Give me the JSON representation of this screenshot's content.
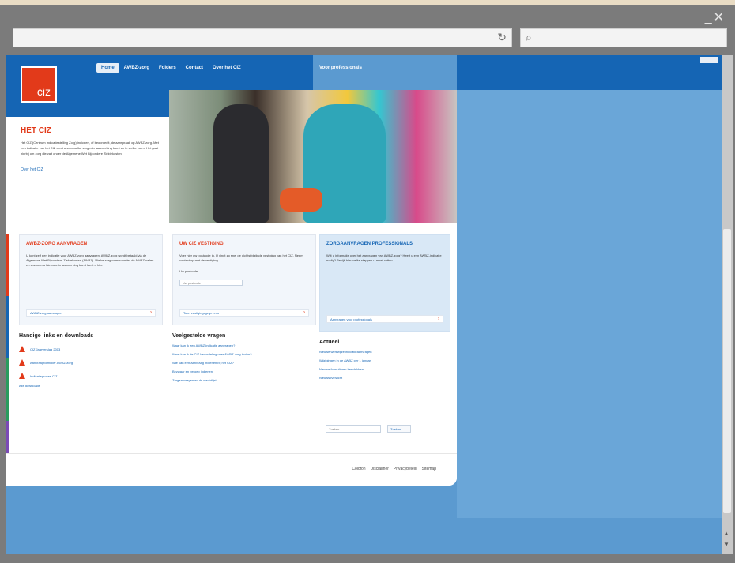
{
  "browser": {
    "window_controls": "_✕",
    "address_refresh_icon": "↻",
    "search_icon": "⌕"
  },
  "site": {
    "logo_text": "ciz",
    "nav": [
      {
        "label": "Home",
        "active": true
      },
      {
        "label": "AWBZ-zorg",
        "active": false
      },
      {
        "label": "Folders",
        "active": false
      },
      {
        "label": "Contact",
        "active": false
      },
      {
        "label": "Over het CIZ",
        "active": false
      }
    ],
    "nav_pro": "Voor professionals",
    "intro": {
      "title": "HET CIZ",
      "text": "Het CIZ (Centrum Indicatiestelling Zorg) indiceert, of beoordeelt, de aanspraak op AWBZ-zorg. Met een indicatie van het CIZ weet u voor welke zorg u in aanmerking komt en in welke vorm. Het gaat hierbij om zorg die valt onder de Algemene Wet Bijzondere Ziektekosten.",
      "more": "Over het CIZ"
    },
    "cards": [
      {
        "title": "AWBZ-ZORG AANVRAGEN",
        "text": "U kunt zelf een indicatie voor AWBZ-zorg aanvragen. AWBZ-zorg wordt betaald via de Algemene Wet Bijzondere Ziektekosten (AWBZ). Welke zorgvormen onder de AWBZ vallen en wanneer u hiervoor in aanmerking komt leest u hier.",
        "button": "AWBZ-zorg aanvragen"
      },
      {
        "title": "UW CIZ VESTIGING",
        "text": "Voer hier uw postcode in. U vindt zo snel de dichtstbijzijnde vestiging van het CIZ. Neem contact op met de vestiging.",
        "input_label": "Uw postcode",
        "input_placeholder": "Uw postcode",
        "button": "Toon vestigingsgegevens"
      },
      {
        "title": "ZORGAANVRAGEN PROFESSIONALS",
        "text": "Wilt u informatie over het aanvragen van AWBZ-zorg? Heeft u een AWBZ-indicatie nodig? Bekijk hier welke stappen u moet zetten.",
        "button": "Aanvragen voor professionals"
      }
    ],
    "downloads": {
      "title": "Handige links en downloads",
      "items": [
        {
          "label": "CIZ Jaarverslag 2013"
        },
        {
          "label": "Aanvraagformulier AWBZ-zorg"
        },
        {
          "label": "Indicatieproces CIZ"
        }
      ],
      "more": "Alle downloads"
    },
    "faq": {
      "title": "Veelgestelde vragen",
      "items": [
        "Waar kan ik een AWBZ-indicatie aanvragen?",
        "Waar kan ik de CIZ-beoordeling over AWBZ-zorg inzien?",
        "Wie kan een aanvraag indienen bij het CIZ?",
        "Bezwaar en beroep indienen",
        "Zorgaanvragen en de wachtlijst"
      ]
    },
    "news": {
      "title": "Actueel",
      "items": [
        {
          "date": "",
          "text": "Nieuwe werkwijze indicatieaanvragen"
        },
        {
          "date": "",
          "text": "Wijzigingen in de AWBZ per 1 januari"
        },
        {
          "date": "",
          "text": "Nieuwe formulieren beschikbaar"
        }
      ],
      "more": "Nieuwsoverzicht"
    },
    "site_search": {
      "placeholder": "Zoeken",
      "button": "Zoeken"
    },
    "footer_links": [
      "Colofon",
      "Disclaimer",
      "Privacybeleid",
      "Sitemap"
    ]
  }
}
